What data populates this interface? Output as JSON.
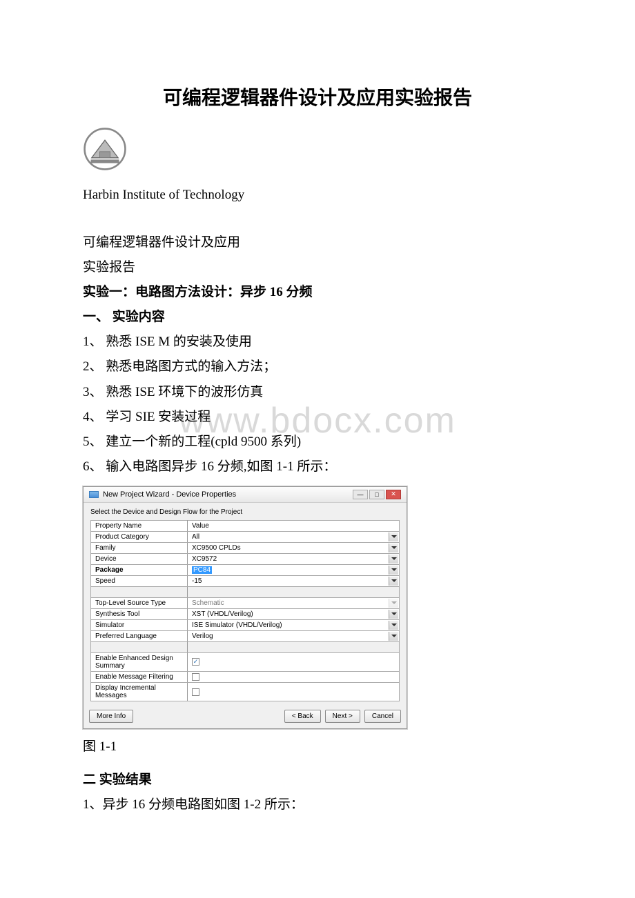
{
  "watermark": "www.bdocx.com",
  "title": "可编程逻辑器件设计及应用实验报告",
  "institution": "Harbin Institute of Technology",
  "subhead1": "可编程逻辑器件设计及应用",
  "subhead2": "实验报告",
  "exp1_heading": " 实验一：电路图方法设计：异步 16 分频",
  "sec1_heading": "一、 实验内容",
  "items": {
    "i1": "1、 熟悉 ISE M 的安装及使用",
    "i2": "2、 熟悉电路图方式的输入方法；",
    "i3": "3、 熟悉 ISE 环境下的波形仿真",
    "i4": "4、 学习 SIE 安装过程",
    "i5": "5、 建立一个新的工程(cpld 9500 系列)",
    "i6": "6、 输入电路图异步 16 分频,如图 1-1 所示："
  },
  "dialog": {
    "title": "New Project Wizard - Device Properties",
    "subtitle": "Select the Device and Design Flow for the Project",
    "headers": {
      "name": "Property Name",
      "value": "Value"
    },
    "rows": {
      "r1": {
        "name": "Product Category",
        "value": "All"
      },
      "r2": {
        "name": "Family",
        "value": "XC9500 CPLDs"
      },
      "r3": {
        "name": "Device",
        "value": "XC9572"
      },
      "r4": {
        "name": "Package",
        "value": "PC84"
      },
      "r5": {
        "name": "Speed",
        "value": "-15"
      },
      "r6": {
        "name": "Top-Level Source Type",
        "value": "Schematic"
      },
      "r7": {
        "name": "Synthesis Tool",
        "value": "XST (VHDL/Verilog)"
      },
      "r8": {
        "name": "Simulator",
        "value": "ISE Simulator (VHDL/Verilog)"
      },
      "r9": {
        "name": "Preferred Language",
        "value": "Verilog"
      },
      "r10": {
        "name": "Enable Enhanced Design Summary"
      },
      "r11": {
        "name": "Enable Message Filtering"
      },
      "r12": {
        "name": "Display Incremental Messages"
      }
    },
    "buttons": {
      "more": "More Info",
      "back": "< Back",
      "next": "Next >",
      "cancel": "Cancel"
    }
  },
  "fig_caption": "图 1-1",
  "sec2_heading": "二 实验结果",
  "result1": "1、异步 16 分频电路图如图 1-2 所示："
}
